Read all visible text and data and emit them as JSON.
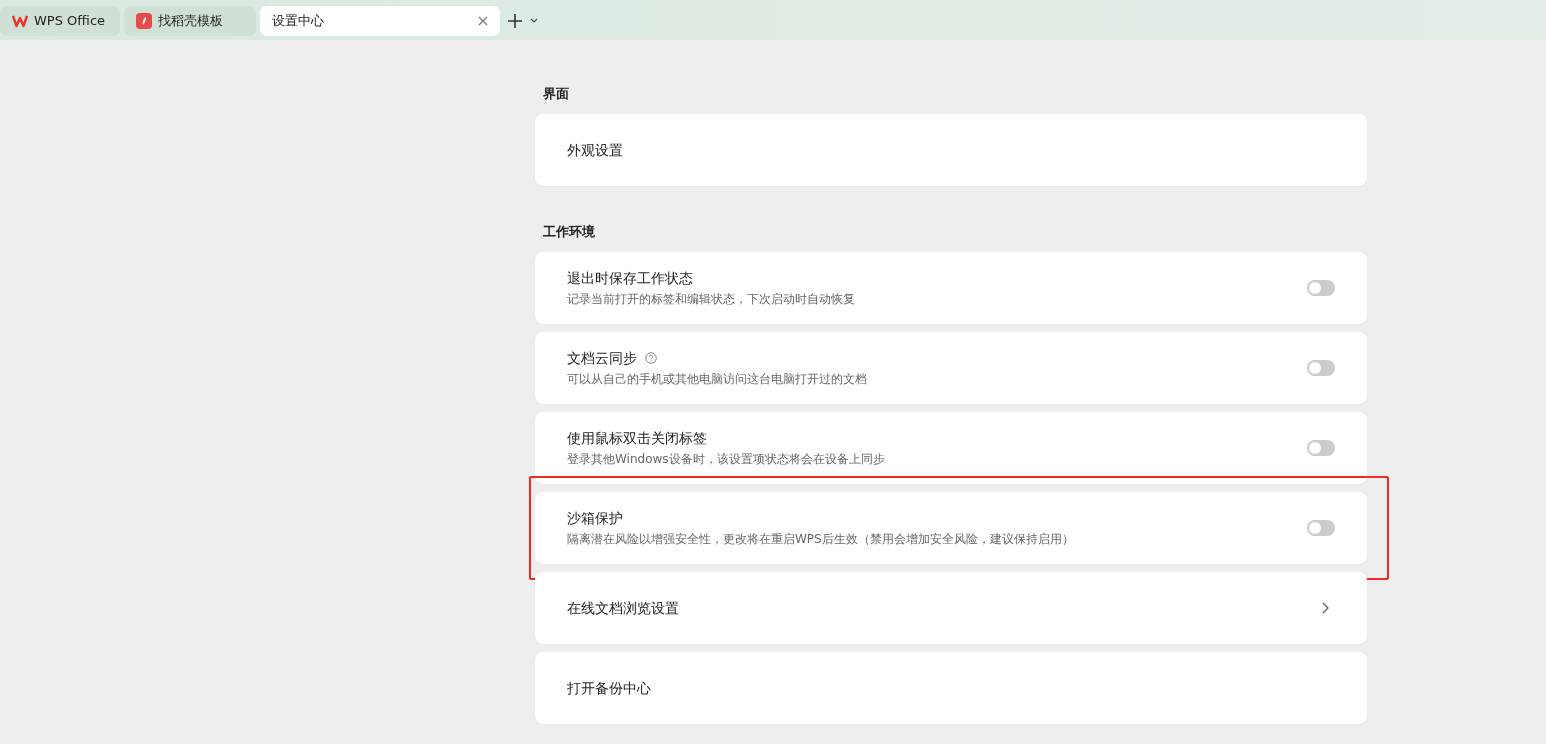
{
  "tabs": [
    {
      "label": "WPS Office",
      "kind": "wps",
      "selected": false
    },
    {
      "label": "找稻壳模板",
      "kind": "docer",
      "selected": false
    },
    {
      "label": "设置中心",
      "kind": "plain",
      "selected": true,
      "closable": true
    }
  ],
  "sections": [
    {
      "title": "界面",
      "items": [
        {
          "kind": "plain",
          "title": "外观设置"
        }
      ]
    },
    {
      "title": "工作环境",
      "items": [
        {
          "kind": "toggle",
          "title": "退出时保存工作状态",
          "description": "记录当前打开的标签和编辑状态，下次启动时自动恢复",
          "on": false
        },
        {
          "kind": "toggle",
          "title": "文档云同步",
          "help": true,
          "description": "可以从自己的手机或其他电脑访问这台电脑打开过的文档",
          "on": false
        },
        {
          "kind": "toggle",
          "title": "使用鼠标双击关闭标签",
          "description": "登录其他Windows设备时，该设置项状态将会在设备上同步",
          "on": false
        },
        {
          "kind": "toggle",
          "title": "沙箱保护",
          "description": "隔离潜在风险以增强安全性，更改将在重启WPS后生效（禁用会增加安全风险，建议保持启用）",
          "on": false,
          "highlighted": true
        },
        {
          "kind": "link",
          "title": "在线文档浏览设置"
        },
        {
          "kind": "plain",
          "title": "打开备份中心"
        }
      ]
    }
  ]
}
